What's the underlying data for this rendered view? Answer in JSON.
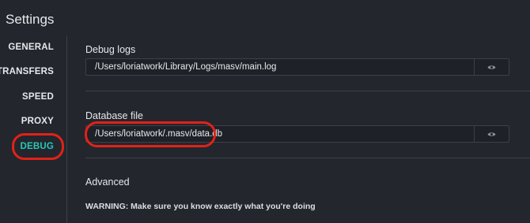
{
  "app": {
    "title": "Settings"
  },
  "sidebar": {
    "items": [
      {
        "label": "GENERAL",
        "active": false
      },
      {
        "label": "TRANSFERS",
        "active": false
      },
      {
        "label": "SPEED",
        "active": false
      },
      {
        "label": "PROXY",
        "active": false
      },
      {
        "label": "DEBUG",
        "active": true
      }
    ]
  },
  "debug_logs": {
    "title": "Debug logs",
    "value": "/Users/loriatwork/Library/Logs/masv/main.log",
    "action_icon": "eye-icon"
  },
  "database_file": {
    "title": "Database file",
    "value": "/Users/loriatwork/.masv/data.db",
    "action_icon": "eye-icon"
  },
  "advanced": {
    "title": "Advanced",
    "warning": "WARNING: Make sure you know exactly what you're doing"
  },
  "colors": {
    "background": "#23262d",
    "accent": "#27c7b8",
    "highlight": "#e02218"
  }
}
